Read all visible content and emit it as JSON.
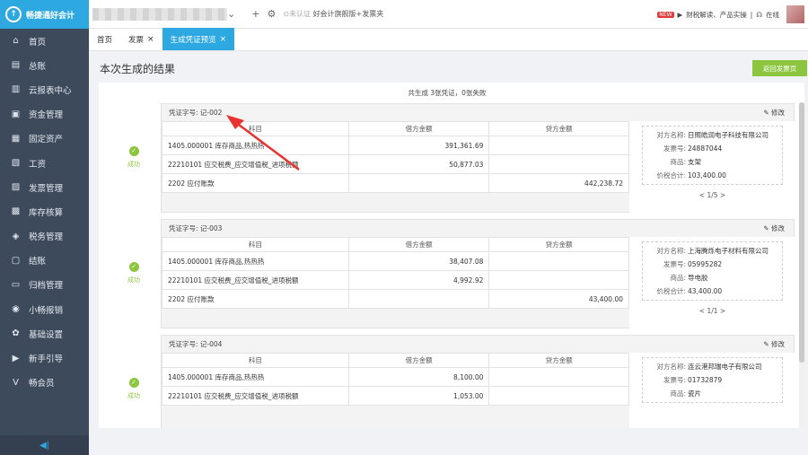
{
  "app": {
    "logo_text": "畅捷通好会计"
  },
  "sidebar": {
    "items": [
      {
        "label": "首页",
        "icon": "home-icon",
        "glyph": "⌂"
      },
      {
        "label": "总账",
        "icon": "ledger-icon",
        "glyph": "▤"
      },
      {
        "label": "云报表中心",
        "icon": "chart-icon",
        "glyph": "▥"
      },
      {
        "label": "资金管理",
        "icon": "wallet-icon",
        "glyph": "▣"
      },
      {
        "label": "固定资产",
        "icon": "asset-icon",
        "glyph": "▦"
      },
      {
        "label": "工资",
        "icon": "salary-icon",
        "glyph": "▧"
      },
      {
        "label": "发票管理",
        "icon": "invoice-icon",
        "glyph": "▨"
      },
      {
        "label": "库存核算",
        "icon": "inventory-icon",
        "glyph": "▩"
      },
      {
        "label": "税务管理",
        "icon": "tax-icon",
        "glyph": "◈"
      },
      {
        "label": "结账",
        "icon": "checkout-icon",
        "glyph": "▢"
      },
      {
        "label": "归档管理",
        "icon": "archive-icon",
        "glyph": "▭"
      },
      {
        "label": "小畅报销",
        "icon": "reimburse-icon",
        "glyph": "◉",
        "dot": true
      },
      {
        "label": "基础设置",
        "icon": "settings-icon",
        "glyph": "✿"
      },
      {
        "label": "新手引导",
        "icon": "guide-icon",
        "glyph": "▶"
      },
      {
        "label": "畅会员",
        "icon": "vip-icon",
        "glyph": "V"
      }
    ]
  },
  "topbar": {
    "cert_prefix": "未认证",
    "cert_text": "好会计旗舰版+发票夹",
    "links": "财税解读、产品实操",
    "online": "在线"
  },
  "tabs": [
    {
      "label": "首页",
      "closable": false
    },
    {
      "label": "发票",
      "closable": true
    },
    {
      "label": "生成凭证预览",
      "closable": true,
      "active": true
    }
  ],
  "page": {
    "title": "本次生成的结果",
    "return_label": "返回发票页",
    "summary": "共生成 3张凭证，0张失败",
    "status_label": "成功",
    "edit_label": "修改"
  },
  "table_headers": {
    "subject": "科目",
    "debit": "借方金额",
    "credit": "贷方金额"
  },
  "info_labels": {
    "party": "对方名称:",
    "invoice_no": "发票号:",
    "goods": "商品:",
    "total": "价税合计:"
  },
  "vouchers": [
    {
      "label": "凭证字号: 记-002",
      "rows": [
        {
          "subject": "1405.000001 库存商品,热热热",
          "debit": "391,361.69",
          "credit": ""
        },
        {
          "subject": "22210101 应交税费_应交增值税_进项税额",
          "debit": "50,877.03",
          "credit": ""
        },
        {
          "subject": "2202 应付账款",
          "debit": "",
          "credit": "442,238.72"
        }
      ],
      "party": "日照皓润电子科技有限公司",
      "invoice_no": "24887044",
      "goods": "支架",
      "total": "103,400.00",
      "pager": "< 1/5 >"
    },
    {
      "label": "凭证字号: 记-003",
      "rows": [
        {
          "subject": "1405.000001 库存商品,热热热",
          "debit": "38,407.08",
          "credit": ""
        },
        {
          "subject": "22210101 应交税费_应交增值税_进项税额",
          "debit": "4,992.92",
          "credit": ""
        },
        {
          "subject": "2202 应付账款",
          "debit": "",
          "credit": "43,400.00"
        }
      ],
      "party": "上海腾烁电子材料有限公司",
      "invoice_no": "05995282",
      "goods": "导电胶",
      "total": "43,400.00",
      "pager": "< 1/1 >"
    },
    {
      "label": "凭证字号: 记-004",
      "rows": [
        {
          "subject": "1405.000001 库存商品,热热热",
          "debit": "8,100.00",
          "credit": ""
        },
        {
          "subject": "22210101 应交税费_应交增值税_进项税额",
          "debit": "1,053.00",
          "credit": ""
        }
      ],
      "party": "连云港邦瑞电子有限公司",
      "invoice_no": "01732879",
      "goods": "瓷片",
      "total": "",
      "pager": ""
    }
  ],
  "colors": {
    "accent": "#2ea8e0",
    "success": "#8cc63f",
    "sidebar": "#3d4a5c",
    "annotation": "#e8332f"
  }
}
